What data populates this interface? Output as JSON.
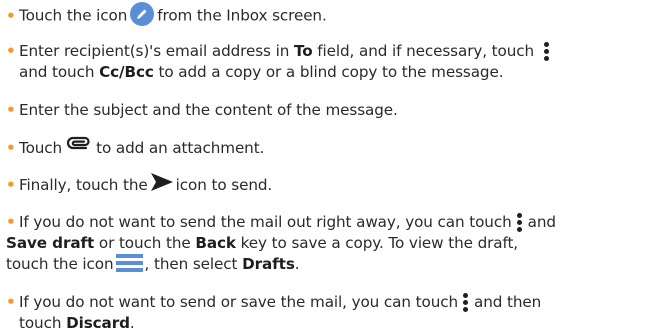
{
  "bullet_char": "•",
  "items": [
    {
      "a": "Touch the icon",
      "b": "from the Inbox screen."
    },
    {
      "l1_a": "Enter recipient(s)'s email address in",
      "l1_to": "To",
      "l1_b": "field, and if necessary, touch",
      "l2_a": "and touch",
      "l2_ccbcc": "Cc/Bcc",
      "l2_b": "to add a copy or a blind copy to the message."
    },
    {
      "a": "Enter the subject and the content of the message."
    },
    {
      "a": "Touch",
      "b": "to add an attachment."
    },
    {
      "a": "Finally, touch the",
      "b": "icon to send."
    },
    {
      "l1": "If you do not want to send the mail out right away, you can touch",
      "l1_end": "and",
      "l2_save": "Save draft",
      "l2_a": "or touch the",
      "l2_back": "Back",
      "l2_b": "key to save a copy. To view the draft,",
      "l3_a": "touch the icon",
      "l3_b": ", then select",
      "l3_drafts": "Drafts",
      "l3_dot": "."
    },
    {
      "l1_a": "If you do not want to send or save the mail, you can touch",
      "l1_b": "and then",
      "l2_a": "touch",
      "l2_discard": "Discard",
      "l2_dot": "."
    }
  ],
  "icons": {
    "compose": "pencil-icon",
    "more": "more-options-icon",
    "attach": "paperclip-icon",
    "send": "send-icon",
    "drawer": "navigation-drawer-icon"
  },
  "colors": {
    "bullet": "#f59a2c",
    "icon_blue": "#5b8ed6",
    "text": "#2a2a2a"
  }
}
